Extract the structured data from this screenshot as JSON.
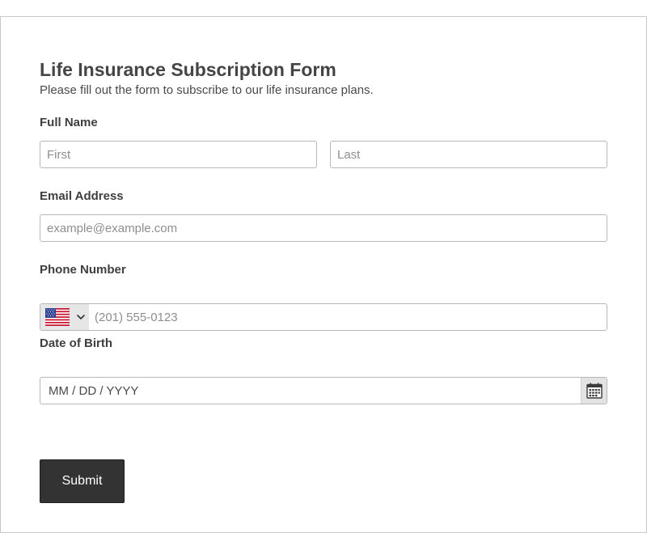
{
  "form": {
    "title": "Life Insurance Subscription Form",
    "subtitle": "Please fill out the form to subscribe to our life insurance plans."
  },
  "full_name": {
    "label": "Full Name",
    "first": {
      "value": "",
      "placeholder": "First"
    },
    "last": {
      "value": "",
      "placeholder": "Last"
    }
  },
  "email": {
    "label": "Email Address",
    "value": "",
    "placeholder": "example@example.com"
  },
  "phone": {
    "label": "Phone Number",
    "country_icon": "us-flag-icon",
    "value": "",
    "placeholder": "(201) 555-0123"
  },
  "dob": {
    "label": "Date of Birth",
    "value": "",
    "placeholder": "MM / DD / YYYY",
    "icon": "calendar-icon"
  },
  "submit": {
    "label": "Submit"
  },
  "colors": {
    "button_bg": "#333333",
    "input_border": "#b8b8b8",
    "text": "#3f3f3f"
  }
}
